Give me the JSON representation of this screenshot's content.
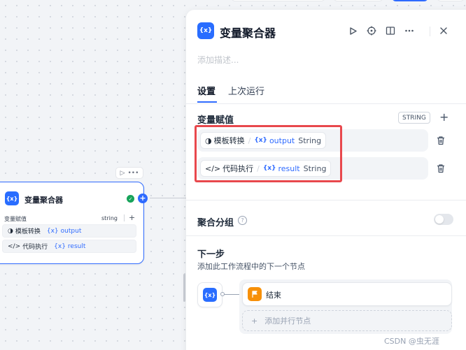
{
  "canvas": {
    "node": {
      "title": "变量聚合器",
      "icon": "variable-icon",
      "icon_text": "{x}",
      "var_label": "变量赋值",
      "type_label": "string",
      "add_symbol": "+",
      "mini_toolbar": {
        "run": "▷",
        "more": "•••"
      },
      "rows": [
        {
          "source_icon": "◑",
          "source": "模板转换",
          "var_icon": "{x}",
          "var": "output"
        },
        {
          "source_icon": "</>",
          "source": "代码执行",
          "var_icon": "{x}",
          "var": "result"
        }
      ]
    }
  },
  "panel": {
    "icon_text": "{x}",
    "title": "变量聚合器",
    "description_placeholder": "添加描述...",
    "tabs": [
      {
        "label": "设置",
        "active": true
      },
      {
        "label": "上次运行",
        "active": false
      }
    ],
    "variables_section": {
      "label": "变量赋值",
      "type_badge": "STRING",
      "add_symbol": "+",
      "rows": [
        {
          "source_icon": "◑",
          "source": "模板转换",
          "sep": "/",
          "var_icon": "{x}",
          "var": "output",
          "type": "String"
        },
        {
          "source_icon": "</>",
          "source": "代码执行",
          "sep": "/",
          "var_icon": "{x}",
          "var": "result",
          "type": "String"
        }
      ]
    },
    "grouping": {
      "label": "聚合分组",
      "help_symbol": "?",
      "enabled": false
    },
    "next_step": {
      "label": "下一步",
      "description": "添加此工作流程中的下一个节点",
      "source_icon_text": "{x}",
      "next_node": {
        "label": "结束",
        "icon": "end-flag-icon"
      },
      "add_parallel": {
        "symbol": "+",
        "label": "添加并行节点"
      }
    }
  },
  "watermark": "CSDN @虫无涯",
  "colors": {
    "accent": "#2f6bff",
    "highlight": "#e8484d",
    "end_node": "#f79009",
    "success": "#17a35a"
  }
}
